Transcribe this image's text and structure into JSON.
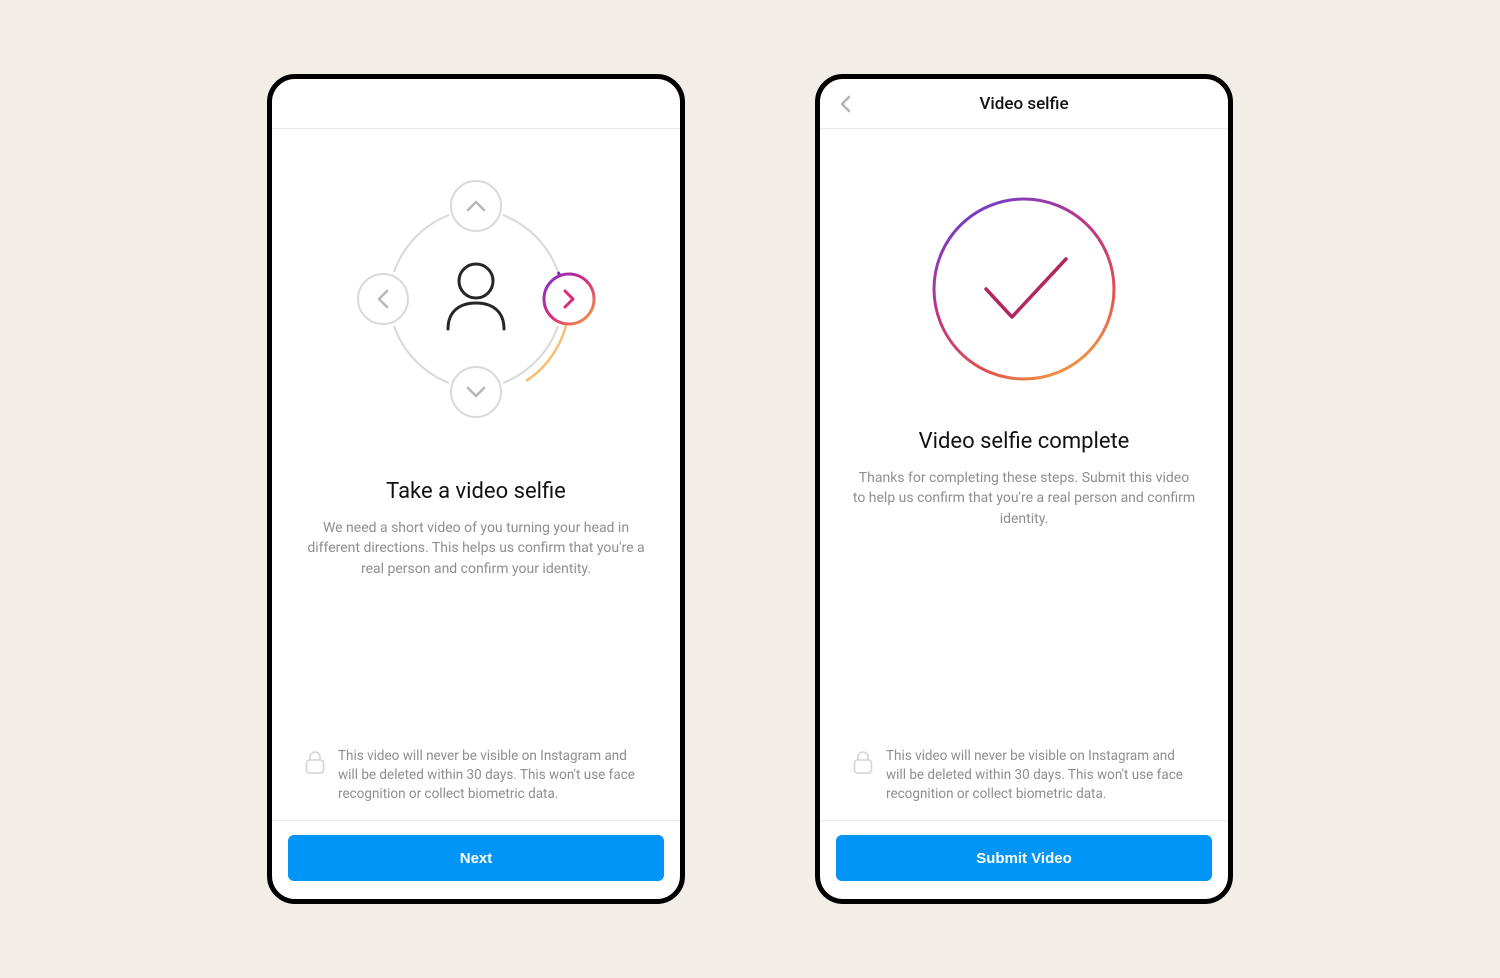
{
  "left": {
    "title": "Take a video selfie",
    "description": "We need a short video of you turning your head in different directions. This helps us confirm that you're a real person and confirm your identity.",
    "footer_info": "This video will never be visible on Instagram and will be deleted within 30 days. This won't use face recognition or collect biometric data.",
    "button_label": "Next"
  },
  "right": {
    "header_title": "Video selfie",
    "title": "Video selfie complete",
    "description": "Thanks for completing these steps. Submit this video to help us confirm that you're a real person and confirm identity.",
    "footer_info": "This video will never be visible on Instagram and will be deleted within 30 days. This won't use face recognition or collect biometric data.",
    "button_label": "Submit Video"
  },
  "colors": {
    "primary_button": "#0095f6",
    "grey_text": "#8e8e8e",
    "grey_stroke": "#d4d4d4",
    "accent_purple": "#7d2ecc",
    "accent_pink": "#d92a7d",
    "accent_orange": "#f7a640"
  }
}
